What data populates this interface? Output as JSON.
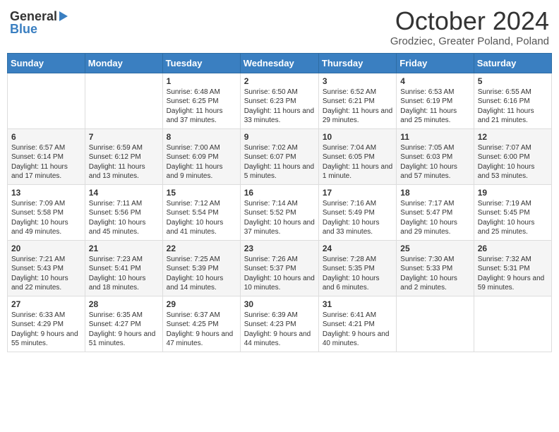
{
  "header": {
    "logo_general": "General",
    "logo_blue": "Blue",
    "title": "October 2024",
    "location": "Grodziec, Greater Poland, Poland"
  },
  "calendar": {
    "days_of_week": [
      "Sunday",
      "Monday",
      "Tuesday",
      "Wednesday",
      "Thursday",
      "Friday",
      "Saturday"
    ],
    "weeks": [
      [
        {
          "day": "",
          "info": ""
        },
        {
          "day": "",
          "info": ""
        },
        {
          "day": "1",
          "info": "Sunrise: 6:48 AM\nSunset: 6:25 PM\nDaylight: 11 hours and 37 minutes."
        },
        {
          "day": "2",
          "info": "Sunrise: 6:50 AM\nSunset: 6:23 PM\nDaylight: 11 hours and 33 minutes."
        },
        {
          "day": "3",
          "info": "Sunrise: 6:52 AM\nSunset: 6:21 PM\nDaylight: 11 hours and 29 minutes."
        },
        {
          "day": "4",
          "info": "Sunrise: 6:53 AM\nSunset: 6:19 PM\nDaylight: 11 hours and 25 minutes."
        },
        {
          "day": "5",
          "info": "Sunrise: 6:55 AM\nSunset: 6:16 PM\nDaylight: 11 hours and 21 minutes."
        }
      ],
      [
        {
          "day": "6",
          "info": "Sunrise: 6:57 AM\nSunset: 6:14 PM\nDaylight: 11 hours and 17 minutes."
        },
        {
          "day": "7",
          "info": "Sunrise: 6:59 AM\nSunset: 6:12 PM\nDaylight: 11 hours and 13 minutes."
        },
        {
          "day": "8",
          "info": "Sunrise: 7:00 AM\nSunset: 6:09 PM\nDaylight: 11 hours and 9 minutes."
        },
        {
          "day": "9",
          "info": "Sunrise: 7:02 AM\nSunset: 6:07 PM\nDaylight: 11 hours and 5 minutes."
        },
        {
          "day": "10",
          "info": "Sunrise: 7:04 AM\nSunset: 6:05 PM\nDaylight: 11 hours and 1 minute."
        },
        {
          "day": "11",
          "info": "Sunrise: 7:05 AM\nSunset: 6:03 PM\nDaylight: 10 hours and 57 minutes."
        },
        {
          "day": "12",
          "info": "Sunrise: 7:07 AM\nSunset: 6:00 PM\nDaylight: 10 hours and 53 minutes."
        }
      ],
      [
        {
          "day": "13",
          "info": "Sunrise: 7:09 AM\nSunset: 5:58 PM\nDaylight: 10 hours and 49 minutes."
        },
        {
          "day": "14",
          "info": "Sunrise: 7:11 AM\nSunset: 5:56 PM\nDaylight: 10 hours and 45 minutes."
        },
        {
          "day": "15",
          "info": "Sunrise: 7:12 AM\nSunset: 5:54 PM\nDaylight: 10 hours and 41 minutes."
        },
        {
          "day": "16",
          "info": "Sunrise: 7:14 AM\nSunset: 5:52 PM\nDaylight: 10 hours and 37 minutes."
        },
        {
          "day": "17",
          "info": "Sunrise: 7:16 AM\nSunset: 5:49 PM\nDaylight: 10 hours and 33 minutes."
        },
        {
          "day": "18",
          "info": "Sunrise: 7:17 AM\nSunset: 5:47 PM\nDaylight: 10 hours and 29 minutes."
        },
        {
          "day": "19",
          "info": "Sunrise: 7:19 AM\nSunset: 5:45 PM\nDaylight: 10 hours and 25 minutes."
        }
      ],
      [
        {
          "day": "20",
          "info": "Sunrise: 7:21 AM\nSunset: 5:43 PM\nDaylight: 10 hours and 22 minutes."
        },
        {
          "day": "21",
          "info": "Sunrise: 7:23 AM\nSunset: 5:41 PM\nDaylight: 10 hours and 18 minutes."
        },
        {
          "day": "22",
          "info": "Sunrise: 7:25 AM\nSunset: 5:39 PM\nDaylight: 10 hours and 14 minutes."
        },
        {
          "day": "23",
          "info": "Sunrise: 7:26 AM\nSunset: 5:37 PM\nDaylight: 10 hours and 10 minutes."
        },
        {
          "day": "24",
          "info": "Sunrise: 7:28 AM\nSunset: 5:35 PM\nDaylight: 10 hours and 6 minutes."
        },
        {
          "day": "25",
          "info": "Sunrise: 7:30 AM\nSunset: 5:33 PM\nDaylight: 10 hours and 2 minutes."
        },
        {
          "day": "26",
          "info": "Sunrise: 7:32 AM\nSunset: 5:31 PM\nDaylight: 9 hours and 59 minutes."
        }
      ],
      [
        {
          "day": "27",
          "info": "Sunrise: 6:33 AM\nSunset: 4:29 PM\nDaylight: 9 hours and 55 minutes."
        },
        {
          "day": "28",
          "info": "Sunrise: 6:35 AM\nSunset: 4:27 PM\nDaylight: 9 hours and 51 minutes."
        },
        {
          "day": "29",
          "info": "Sunrise: 6:37 AM\nSunset: 4:25 PM\nDaylight: 9 hours and 47 minutes."
        },
        {
          "day": "30",
          "info": "Sunrise: 6:39 AM\nSunset: 4:23 PM\nDaylight: 9 hours and 44 minutes."
        },
        {
          "day": "31",
          "info": "Sunrise: 6:41 AM\nSunset: 4:21 PM\nDaylight: 9 hours and 40 minutes."
        },
        {
          "day": "",
          "info": ""
        },
        {
          "day": "",
          "info": ""
        }
      ]
    ]
  }
}
